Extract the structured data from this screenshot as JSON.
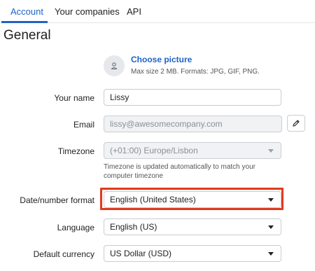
{
  "tabs": [
    {
      "label": "Account",
      "active": true
    },
    {
      "label": "Your companies",
      "active": false
    },
    {
      "label": "API",
      "active": false
    }
  ],
  "section_title": "General",
  "picture": {
    "choose_label": "Choose picture",
    "hint": "Max size 2 MB. Formats: JPG, GIF, PNG."
  },
  "fields": {
    "name": {
      "label": "Your name",
      "value": "Lissy"
    },
    "email": {
      "label": "Email",
      "value": "lissy@awesomecompany.com",
      "disabled": true
    },
    "timezone": {
      "label": "Timezone",
      "value": "(+01:00) Europe/Lisbon",
      "disabled": true,
      "hint": "Timezone is updated automatically to match your computer timezone"
    },
    "date_format": {
      "label": "Date/number format",
      "value": "English (United States)",
      "highlighted": true
    },
    "language": {
      "label": "Language",
      "value": "English (US)"
    },
    "currency": {
      "label": "Default currency",
      "value": "US Dollar (USD)"
    }
  },
  "colors": {
    "accent": "#1f63c6",
    "highlight": "#e03a1e",
    "disabled_bg": "#f1f2f4",
    "border": "#c9cdd2"
  },
  "icons": {
    "avatar": "user-icon",
    "edit": "pencil-icon",
    "dropdown": "chevron-down-icon"
  }
}
